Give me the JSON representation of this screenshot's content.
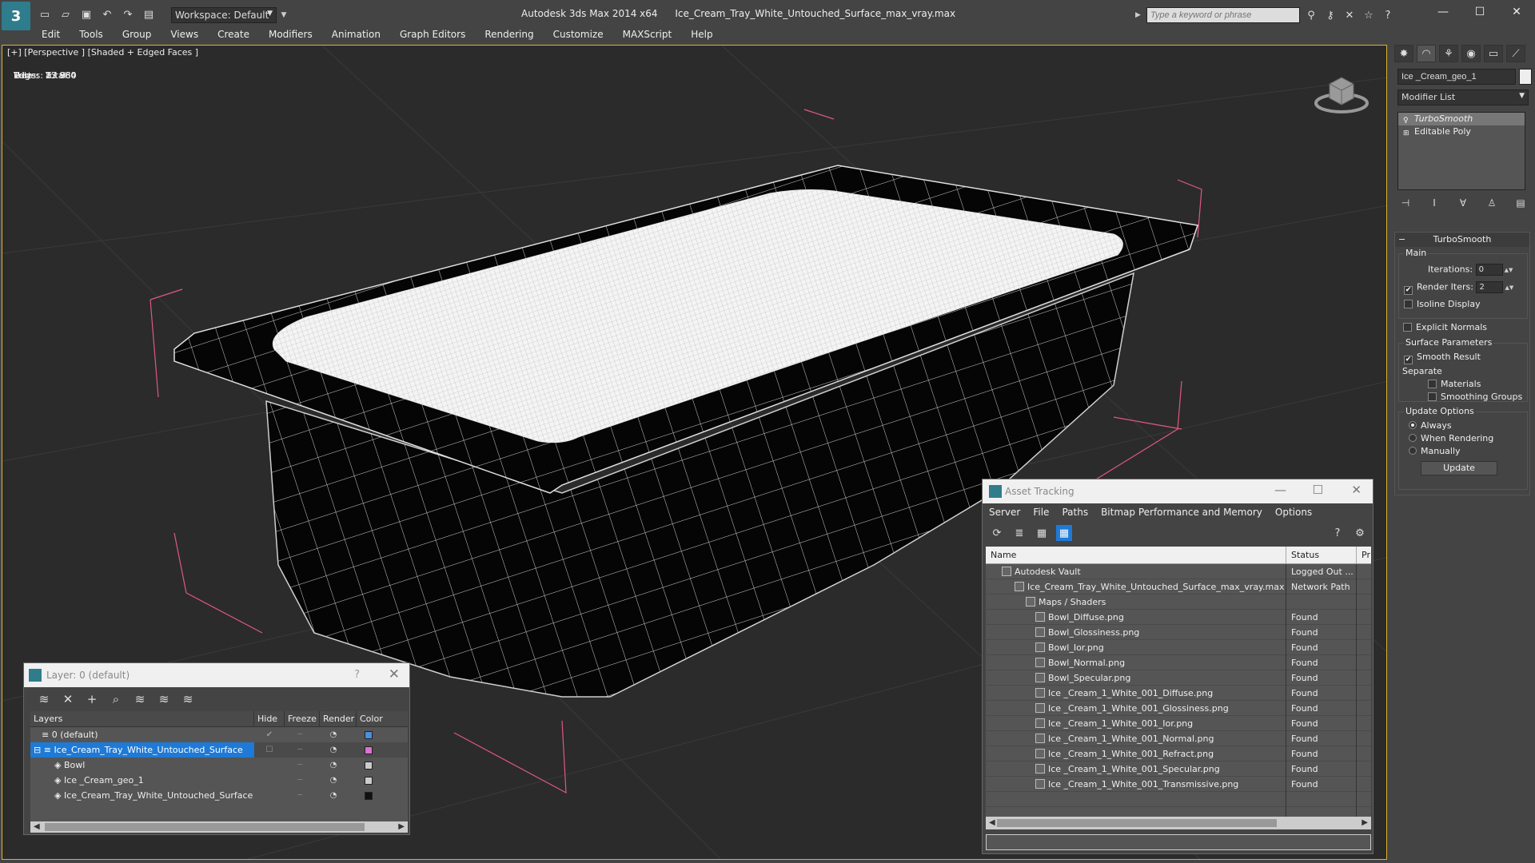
{
  "app": {
    "logo_letter": "3",
    "title_app": "Autodesk 3ds Max  2014 x64",
    "title_file": "Ice_Cream_Tray_White_Untouched_Surface_max_vray.max",
    "workspace": "Workspace: Default",
    "search_placeholder": "Type a keyword or phrase"
  },
  "menu": [
    "Edit",
    "Tools",
    "Group",
    "Views",
    "Create",
    "Modifiers",
    "Animation",
    "Graph Editors",
    "Rendering",
    "Customize",
    "MAXScript",
    "Help"
  ],
  "viewport": {
    "label": "[+] [Perspective ] [Shaded + Edged Faces ]",
    "stats": {
      "header": "Total",
      "polys_label": "Polys:",
      "polys": "27 960",
      "tris_label": "Tris:",
      "tris": "27 960",
      "edges_label": "Edges:",
      "edges": "83 880",
      "verts_label": "Verts:",
      "verts": "13 984"
    }
  },
  "layer_dialog": {
    "title": "Layer: 0 (default)",
    "help": "?",
    "columns": {
      "layers": "Layers",
      "hide": "Hide",
      "freeze": "Freeze",
      "render": "Render",
      "color": "Color"
    },
    "rows": [
      {
        "name": "0 (default)",
        "color": "#4a8fe0"
      },
      {
        "name": "Ice_Cream_Tray_White_Untouched_Surface",
        "color": "#e070d0"
      },
      {
        "name": "Bowl",
        "color": "#cccccc"
      },
      {
        "name": "Ice _Cream_geo_1",
        "color": "#cccccc"
      },
      {
        "name": "Ice_Cream_Tray_White_Untouched_Surface",
        "color": "#111111"
      }
    ]
  },
  "asset_dialog": {
    "title": "Asset Tracking",
    "menu": [
      "Server",
      "File",
      "Paths",
      "Bitmap Performance and Memory",
      "Options"
    ],
    "columns": {
      "name": "Name",
      "status": "Status",
      "extra": "Pr"
    },
    "rows": [
      {
        "name": "Autodesk Vault",
        "status": "Logged Out ..."
      },
      {
        "name": "Ice_Cream_Tray_White_Untouched_Surface_max_vray.max",
        "status": "Network Path"
      },
      {
        "name": "Maps / Shaders",
        "status": ""
      },
      {
        "name": "Bowl_Diffuse.png",
        "status": "Found"
      },
      {
        "name": "Bowl_Glossiness.png",
        "status": "Found"
      },
      {
        "name": "Bowl_Ior.png",
        "status": "Found"
      },
      {
        "name": "Bowl_Normal.png",
        "status": "Found"
      },
      {
        "name": "Bowl_Specular.png",
        "status": "Found"
      },
      {
        "name": "Ice _Cream_1_White_001_Diffuse.png",
        "status": "Found"
      },
      {
        "name": "Ice _Cream_1_White_001_Glossiness.png",
        "status": "Found"
      },
      {
        "name": "Ice _Cream_1_White_001_Ior.png",
        "status": "Found"
      },
      {
        "name": "Ice _Cream_1_White_001_Normal.png",
        "status": "Found"
      },
      {
        "name": "Ice _Cream_1_White_001_Refract.png",
        "status": "Found"
      },
      {
        "name": "Ice _Cream_1_White_001_Specular.png",
        "status": "Found"
      },
      {
        "name": "Ice _Cream_1_White_001_Transmissive.png",
        "status": "Found"
      }
    ]
  },
  "command_panel": {
    "object_name": "Ice _Cream_geo_1",
    "modifier_list": "Modifier List",
    "stack": [
      "TurboSmooth",
      "Editable Poly"
    ],
    "rollout_title": "TurboSmooth",
    "main_label": "Main",
    "iterations_label": "Iterations:",
    "iterations": "0",
    "render_iters_label": "Render Iters:",
    "render_iters": "2",
    "isoline": "Isoline Display",
    "explicit_normals": "Explicit Normals",
    "surface_params": "Surface Parameters",
    "smooth_result": "Smooth Result",
    "separate": "Separate",
    "materials": "Materials",
    "smoothing_groups": "Smoothing Groups",
    "update_options": "Update Options",
    "always": "Always",
    "when_rendering": "When Rendering",
    "manually": "Manually",
    "update_button": "Update"
  }
}
